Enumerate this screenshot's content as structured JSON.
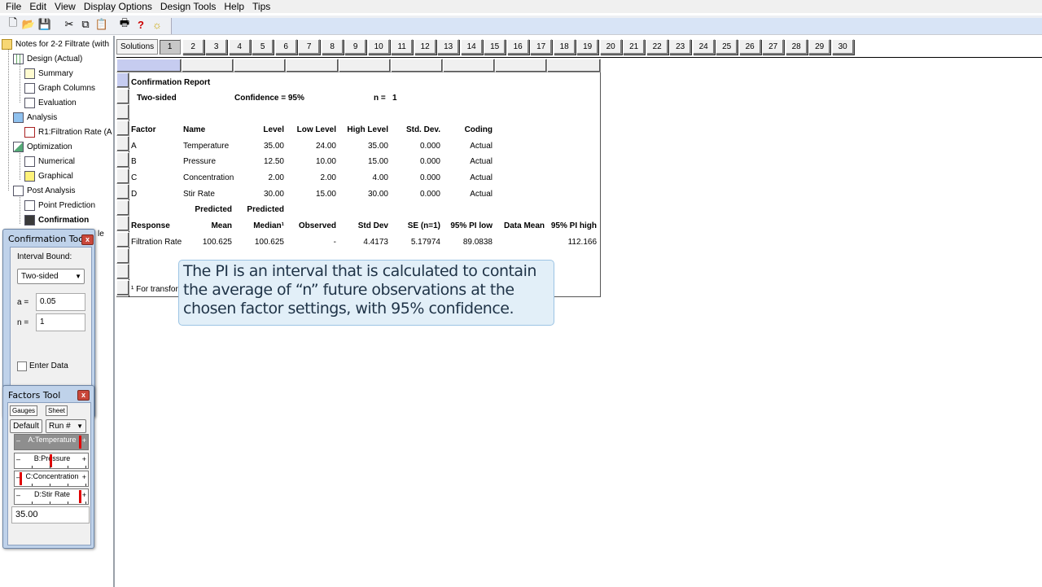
{
  "menu": [
    "File",
    "Edit",
    "View",
    "Display Options",
    "Design Tools",
    "Help",
    "Tips"
  ],
  "toolbar": {
    "icons": [
      "new-file-icon",
      "open-folder-icon",
      "save-icon",
      "cut-icon",
      "copy-icon",
      "paste-icon",
      "print-icon",
      "help-icon",
      "tip-bulb-icon"
    ],
    "glyphs": {
      "new": "🗋",
      "open": "📂",
      "save": "💾",
      "cut": "✂",
      "copy": "⧉",
      "paste": "📋",
      "print": "🖶",
      "help": "?",
      "tip": "☼"
    }
  },
  "tree": {
    "root": "Notes for 2-2 Filtrate (with",
    "design": "Design (Actual)",
    "summary": "Summary",
    "graph_columns": "Graph Columns",
    "evaluation": "Evaluation",
    "analysis": "Analysis",
    "r1": "R1:Filtration Rate (A",
    "optimization": "Optimization",
    "numerical": "Numerical",
    "graphical": "Graphical",
    "post_analysis": "Post Analysis",
    "point_prediction": "Point Prediction",
    "confirmation": "Confirmation",
    "partial": "le"
  },
  "solutions": {
    "label": "Solutions",
    "tabs": [
      "1",
      "2",
      "3",
      "4",
      "5",
      "6",
      "7",
      "8",
      "9",
      "10",
      "11",
      "12",
      "13",
      "14",
      "15",
      "16",
      "17",
      "18",
      "19",
      "20",
      "21",
      "22",
      "23",
      "24",
      "25",
      "26",
      "27",
      "28",
      "29",
      "30"
    ]
  },
  "report": {
    "title": "Confirmation Report",
    "sided": "Two-sided",
    "confidence": "Confidence = 95%",
    "n_label": "n =",
    "n_value": "1",
    "factor_headers": [
      "Factor",
      "Name",
      "Level",
      "Low Level",
      "High Level",
      "Std. Dev.",
      "Coding"
    ],
    "factors": [
      [
        "A",
        "Temperature",
        "35.00",
        "24.00",
        "35.00",
        "0.000",
        "Actual"
      ],
      [
        "B",
        "Pressure",
        "12.50",
        "10.00",
        "15.00",
        "0.000",
        "Actual"
      ],
      [
        "C",
        "Concentration",
        "2.00",
        "2.00",
        "4.00",
        "0.000",
        "Actual"
      ],
      [
        "D",
        "Stir Rate",
        "30.00",
        "15.00",
        "30.00",
        "0.000",
        "Actual"
      ]
    ],
    "predicted_1": "Predicted",
    "predicted_2": "Predicted",
    "response_headers": [
      "Response",
      "Mean",
      "Median¹",
      "Observed",
      "Std Dev",
      "SE (n=1)",
      "95% PI low",
      "Data Mean",
      "95% PI high"
    ],
    "response_row": [
      "Filtration Rate",
      "100.625",
      "100.625",
      "-",
      "4.4173",
      "5.17974",
      "89.0838",
      "",
      "112.166"
    ],
    "footnote": "¹ For transfor"
  },
  "callout": {
    "text": "The PI is an interval that is calculated to contain the average of  “n” future observations at the chosen factor settings, with 95% confidence."
  },
  "confirmation_tool": {
    "title": "Confirmation Tool",
    "interval_bound_label": "Interval Bound:",
    "interval_bound_value": "Two-sided",
    "alpha_label": "a =",
    "alpha_value": "0.05",
    "n_label": "n =",
    "n_value": "1",
    "enter_data_label": "Enter Data"
  },
  "factors_tool": {
    "title": "Factors Tool",
    "gauges_label": "Gauges",
    "sheet_label": "Sheet",
    "default_label": "Default",
    "run_label": "Run #",
    "sliders": [
      {
        "label": "A:Temperature",
        "level": 1.0
      },
      {
        "label": "B:Pressure",
        "level": 0.5
      },
      {
        "label": "C:Concentration",
        "level": 0.0
      },
      {
        "label": "D:Stir Rate",
        "level": 1.0
      }
    ],
    "value": "35.00"
  },
  "colors": {
    "selection": "#c6ccf0",
    "tool_frame": "#bfd2ea",
    "callout_bg": "#e2eff8",
    "marker": "#e00000"
  }
}
